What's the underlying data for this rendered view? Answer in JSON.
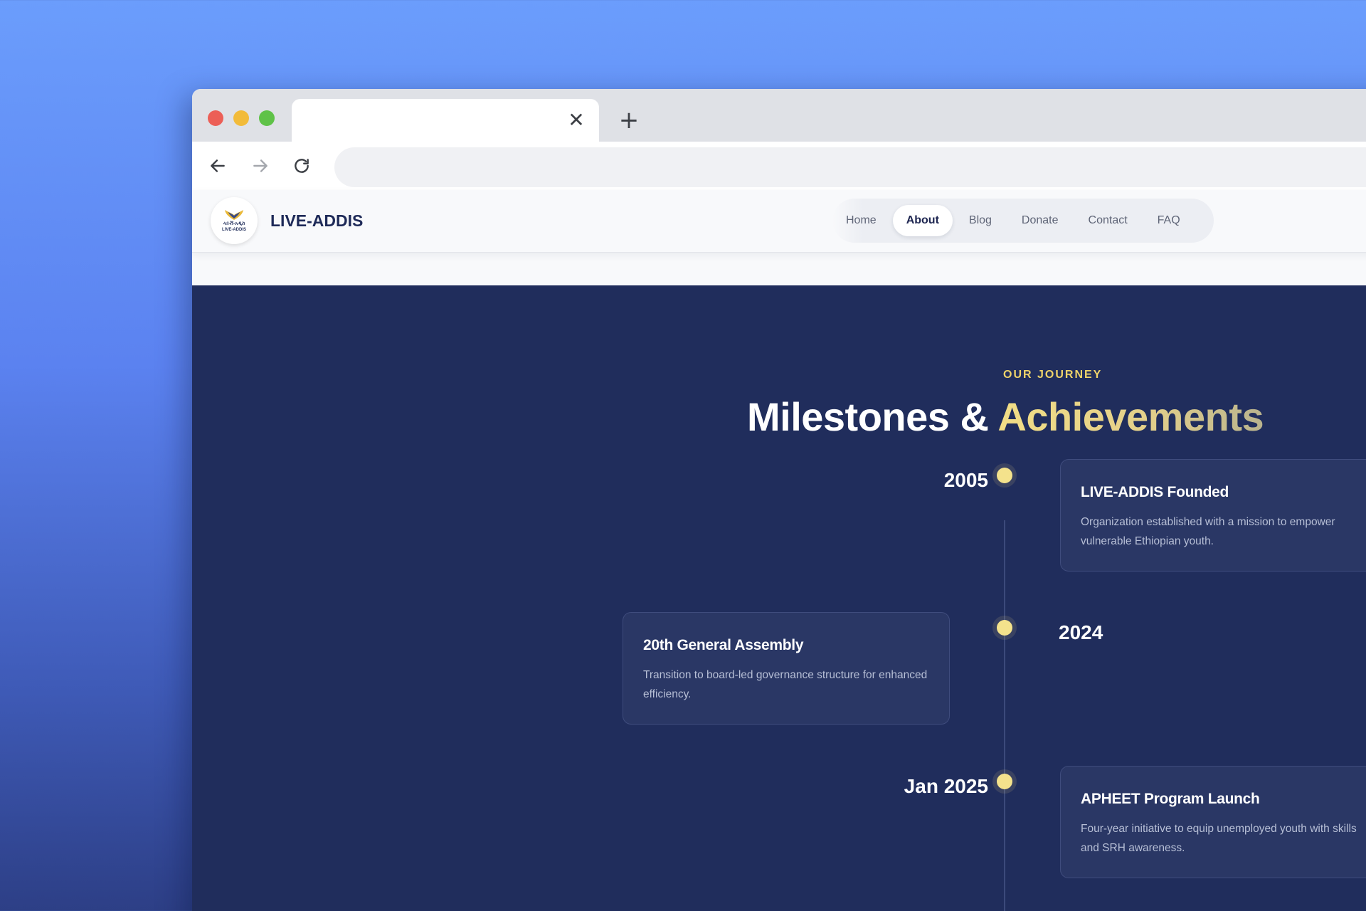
{
  "browser": {
    "tab": {
      "title": "",
      "close_icon": "close-icon"
    },
    "new_tab_icon": "plus-icon",
    "address_bar": {
      "value": ""
    }
  },
  "site": {
    "brand": "LIVE-ADDIS",
    "logo_text": "ላይቭ-አዲስ",
    "logo_subtext": "LIVE-ADDIS",
    "nav": [
      {
        "label": "Home",
        "active": false
      },
      {
        "label": "About",
        "active": true
      },
      {
        "label": "Blog",
        "active": false
      },
      {
        "label": "Donate",
        "active": false
      },
      {
        "label": "Contact",
        "active": false
      },
      {
        "label": "FAQ",
        "active": false
      }
    ]
  },
  "section": {
    "eyebrow": "OUR JOURNEY",
    "title_main": "Milestones & ",
    "title_accent": "Achievements",
    "milestones": [
      {
        "year": "2005",
        "title": "LIVE-ADDIS Founded",
        "description": "Organization established with a mission to empower vulnerable Ethiopian youth."
      },
      {
        "year": "2024",
        "title": "20th General Assembly",
        "description": "Transition to board-led governance structure for enhanced efficiency."
      },
      {
        "year": "Jan 2025",
        "title": "APHEET Program Launch",
        "description": "Four-year initiative to equip unemployed youth with skills and SRH awareness."
      }
    ]
  },
  "colors": {
    "section_bg": "#202d5c",
    "accent_gold": "#f0d46a",
    "card_bg": "#2a3765",
    "brand_navy": "#1e2a58"
  }
}
